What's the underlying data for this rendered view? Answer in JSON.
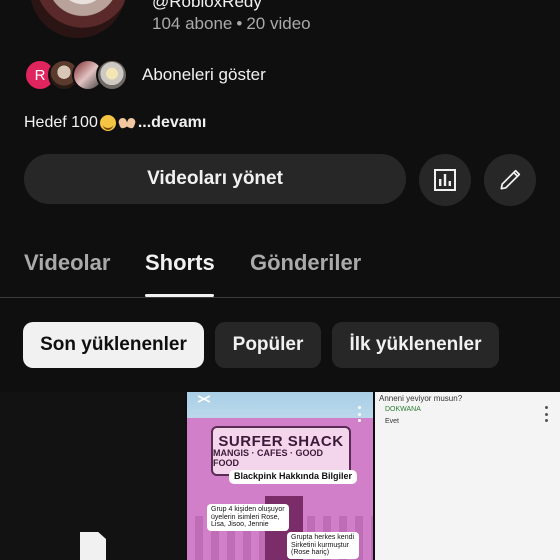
{
  "channel": {
    "handle": "@RobloxRedy",
    "subscribers": "104 abone",
    "separator": "•",
    "videos": "20 video"
  },
  "subscribers_row": {
    "first_initial": "R",
    "label": "Aboneleri göster"
  },
  "bio": {
    "text": "Hedef 100",
    "more": "...devamı"
  },
  "actions": {
    "manage_label": "Videoları yönet",
    "analytics_icon": "bar-chart-icon",
    "edit_icon": "pencil-icon"
  },
  "tabs": [
    {
      "label": "Videolar",
      "active": false
    },
    {
      "label": "Shorts",
      "active": true
    },
    {
      "label": "Gönderiler",
      "active": false
    }
  ],
  "filters": [
    {
      "label": "Son yüklenenler",
      "selected": true
    },
    {
      "label": "Popüler",
      "selected": false
    },
    {
      "label": "İlk yüklenenler",
      "selected": false
    }
  ],
  "shorts": [
    {
      "kind": "placeholder"
    },
    {
      "sign_main": "SURFER SHACK",
      "sign_sub": "MANGIS · CAFES · GOOD FOOD",
      "caption": "Blackpink Hakkında Bilgiler",
      "note_1": "Grup 4 kişiden oluşuyor üyelerin isimleri Rose, Lisa, Jisoo, Jennie",
      "note_2": "Grupta herkes kendi Sirketini kurmuştur (Rose hariç)"
    },
    {
      "top_text": "Anneni yeviyor musun?",
      "line_name": "DOKWANA",
      "line_reply": "Evet"
    }
  ],
  "colors": {
    "background": "#0f0f0f",
    "surface": "#272727",
    "text": "#f1f1f1",
    "muted": "#aaaaaa",
    "avatar_red": "#e0245e"
  }
}
